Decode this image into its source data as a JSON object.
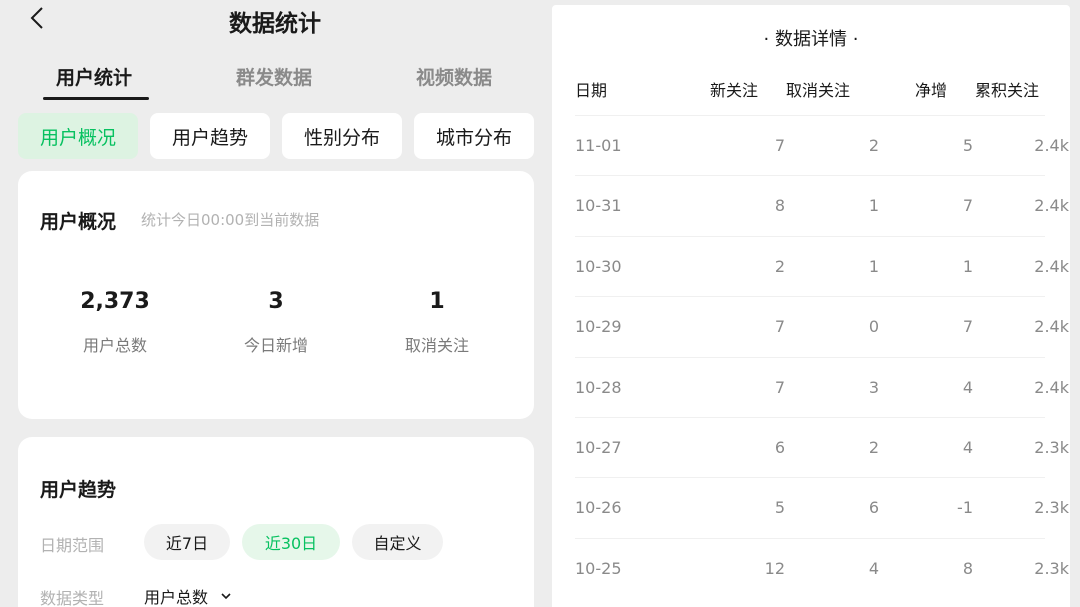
{
  "app": {
    "title": "数据统计"
  },
  "tabs": [
    {
      "label": "用户统计",
      "active": true
    },
    {
      "label": "群发数据",
      "active": false
    },
    {
      "label": "视频数据",
      "active": false
    }
  ],
  "subtabs": [
    {
      "label": "用户概况",
      "active": true
    },
    {
      "label": "用户趋势",
      "active": false
    },
    {
      "label": "性别分布",
      "active": false
    },
    {
      "label": "城市分布",
      "active": false
    }
  ],
  "overview": {
    "title": "用户概况",
    "hint": "统计今日00:00到当前数据",
    "stats": [
      {
        "value": "2,373",
        "label": "用户总数"
      },
      {
        "value": "3",
        "label": "今日新增"
      },
      {
        "value": "1",
        "label": "取消关注"
      }
    ]
  },
  "trend": {
    "title": "用户趋势",
    "date_range_label": "日期范围",
    "ranges": [
      {
        "label": "近7日",
        "active": false
      },
      {
        "label": "近30日",
        "active": true
      },
      {
        "label": "自定义",
        "active": false
      }
    ],
    "data_type_label": "数据类型",
    "data_type_value": "用户总数"
  },
  "details": {
    "title": "· 数据详情 ·",
    "headers": [
      "日期",
      "新关注",
      "取消关注",
      "净增",
      "累积关注"
    ],
    "rows": [
      [
        "11-01",
        "7",
        "2",
        "5",
        "2.4k"
      ],
      [
        "10-31",
        "8",
        "1",
        "7",
        "2.4k"
      ],
      [
        "10-30",
        "2",
        "1",
        "1",
        "2.4k"
      ],
      [
        "10-29",
        "7",
        "0",
        "7",
        "2.4k"
      ],
      [
        "10-28",
        "7",
        "3",
        "4",
        "2.4k"
      ],
      [
        "10-27",
        "6",
        "2",
        "4",
        "2.3k"
      ],
      [
        "10-26",
        "5",
        "6",
        "-1",
        "2.3k"
      ],
      [
        "10-25",
        "12",
        "4",
        "8",
        "2.3k"
      ]
    ]
  },
  "colors": {
    "accent": "#07c160",
    "accent_bg": "#ddf3e2",
    "background": "#ededed"
  }
}
